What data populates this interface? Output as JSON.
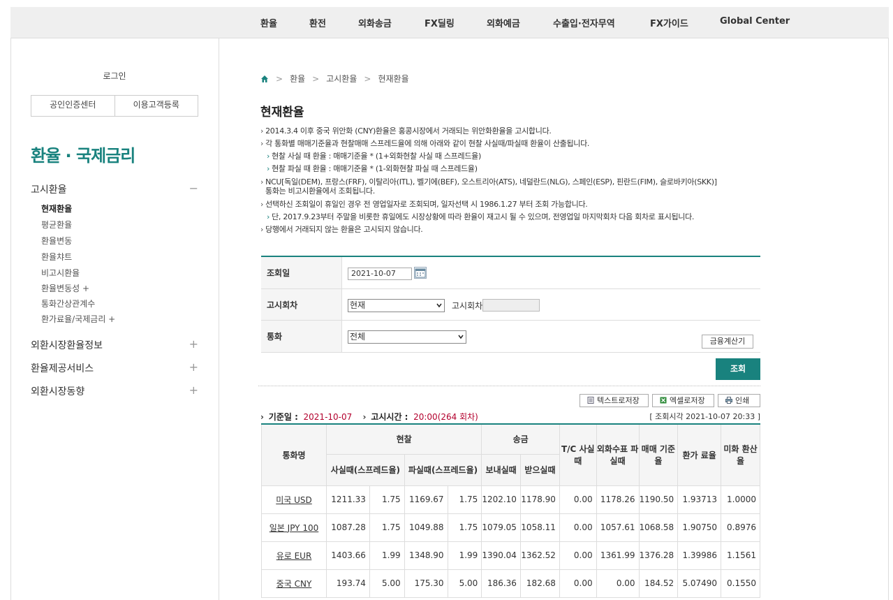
{
  "topnav": [
    "환율",
    "환전",
    "외화송금",
    "FX딜링",
    "외화예금",
    "수출입·전자무역",
    "FX가이드",
    "Global Center"
  ],
  "login": {
    "title": "로그인",
    "cert_button": "공인인증센터",
    "register_button": "이용고객등록"
  },
  "sidebar": {
    "title": "환율 · 국제금리",
    "sections": [
      {
        "label": "고시환율",
        "toggle": "−"
      },
      {
        "label": "외환시장환율정보",
        "toggle": "+"
      },
      {
        "label": "환율제공서비스",
        "toggle": "+"
      },
      {
        "label": "외환시장동향",
        "toggle": "+"
      }
    ],
    "sub_items": [
      "현재환율",
      "평균환율",
      "환율변동",
      "환율챠트",
      "비고시환율",
      "환율변동성 +",
      "통화간상관계수",
      "환가료율/국제금리 +"
    ]
  },
  "breadcrumb": [
    "환율",
    "고시환율",
    "현재환율"
  ],
  "page_title": "현재환율",
  "notices": [
    "2014.3.4 이후 중국 위안화 (CNY)환율은 홍콩시장에서 거래되는 위안화환율을 고시합니다.",
    "각 통화별 매매기준율과 현찰매매 스프레드율에 의해 아래와 같이 현찰 사실때/파실때 환율이 산출됩니다.",
    "현찰 사실 때 환율 : 매매기준율 * (1+외화현찰 사실 때 스프레드율)",
    "현찰 파실 때 환율 : 매매기준율 * (1-외화현찰 파실 때 스프레드율)",
    "NCU[독일(DEM), 프랑스(FRF), 이탈리아(ITL), 벨기에(BEF), 오스트리아(ATS), 네덜란드(NLG), 스페인(ESP), 핀란드(FIM), 슬로바키아(SKK)]",
    "통화는 비고시환율에서 조회됩니다.",
    "선택하신 조회일이 휴일인 경우 전 영업일자로 조회되며, 일자선택 시 1986.1.27 부터 조회 가능합니다.",
    "단, 2017.9.23부터 주말을 비롯한 휴일에도 시장상황에 따라 환율이 재고시 될 수 있으며, 전영업일 마지막회차 다음 회차로 표시됩니다.",
    "당행에서 거래되지 않는 환율은 고시되지 않습니다."
  ],
  "form": {
    "date_label": "조회일",
    "date_value": "2021-10-07",
    "round_label": "고시회차",
    "round_value": "현재",
    "round_input_label": "고시회차",
    "currency_label": "통화",
    "currency_value": "전체",
    "calc_button": "금융계산기",
    "search_button": "조회"
  },
  "tools": {
    "text_save": "텍스트로저장",
    "excel_save": "엑셀로저장",
    "print": "인쇄"
  },
  "info": {
    "base_date_label": "기준일 :",
    "base_date": "2021-10-07",
    "notice_time_label": "고시시간 :",
    "notice_time": "20:00(264 회차)",
    "query_time": "[ 조회시각 2021-10-07 20:33 ]"
  },
  "table": {
    "headers": {
      "currency": "통화명",
      "cash": "현찰",
      "remit": "송금",
      "cash_buy": "사실때(스프레드율)",
      "cash_sell": "파실때(스프레드율)",
      "remit_send": "보내실때",
      "remit_recv": "받으실때",
      "tc": "T/C 사실때",
      "check": "외화수표 파실때",
      "base": "매매 기준율",
      "fee": "환가 료율",
      "usd": "미화 환산율"
    },
    "rows": [
      {
        "currency": "미국 USD",
        "cash_buy": "1211.33",
        "cash_buy_sp": "1.75",
        "cash_sell": "1169.67",
        "cash_sell_sp": "1.75",
        "send": "1202.10",
        "recv": "1178.90",
        "tc": "0.00",
        "check": "1178.26",
        "base": "1190.50",
        "fee": "1.93713",
        "usd": "1.0000"
      },
      {
        "currency": "일본 JPY 100",
        "cash_buy": "1087.28",
        "cash_buy_sp": "1.75",
        "cash_sell": "1049.88",
        "cash_sell_sp": "1.75",
        "send": "1079.05",
        "recv": "1058.11",
        "tc": "0.00",
        "check": "1057.61",
        "base": "1068.58",
        "fee": "1.90750",
        "usd": "0.8976"
      },
      {
        "currency": "유로 EUR",
        "cash_buy": "1403.66",
        "cash_buy_sp": "1.99",
        "cash_sell": "1348.90",
        "cash_sell_sp": "1.99",
        "send": "1390.04",
        "recv": "1362.52",
        "tc": "0.00",
        "check": "1361.99",
        "base": "1376.28",
        "fee": "1.39986",
        "usd": "1.1561"
      },
      {
        "currency": "중국 CNY",
        "cash_buy": "193.74",
        "cash_buy_sp": "5.00",
        "cash_sell": "175.30",
        "cash_sell_sp": "5.00",
        "send": "186.36",
        "recv": "182.68",
        "tc": "0.00",
        "check": "0.00",
        "base": "184.52",
        "fee": "5.07490",
        "usd": "0.1550"
      }
    ]
  },
  "colors": {
    "accent": "#19827e",
    "highlight": "#b3002d"
  }
}
